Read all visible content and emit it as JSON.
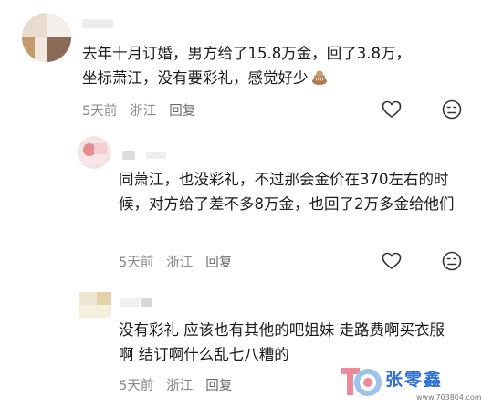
{
  "comments": [
    {
      "text": "去年十月订婚，男方给了15.8万金，回了3.8万，坐标萧江，没有要彩礼，感觉好少",
      "emoji": "poop-emoji",
      "time": "5天前",
      "location": "浙江",
      "reply_label": "回复"
    },
    {
      "text": "同萧江，也没彩礼，不过那会金价在370左右的时候，对方给了差不多8万金，也回了2万多金给他们",
      "time": "5天前",
      "location": "浙江",
      "reply_label": "回复"
    },
    {
      "text": "没有彩礼 应该也有其他的吧姐妹 走路费啊买衣服啊 结订啊什么乱七八糟的",
      "time": "5天前",
      "location": "浙江",
      "reply_label": "回复"
    }
  ],
  "icons": {
    "like": "heart-icon",
    "dislike": "dislike-face-icon"
  },
  "watermark": {
    "brand": "张零鑫",
    "url": "www.703804.com"
  },
  "colors": {
    "meta": "#8a8a8a",
    "icon": "#333333",
    "watermark": "#2f6fd6"
  }
}
